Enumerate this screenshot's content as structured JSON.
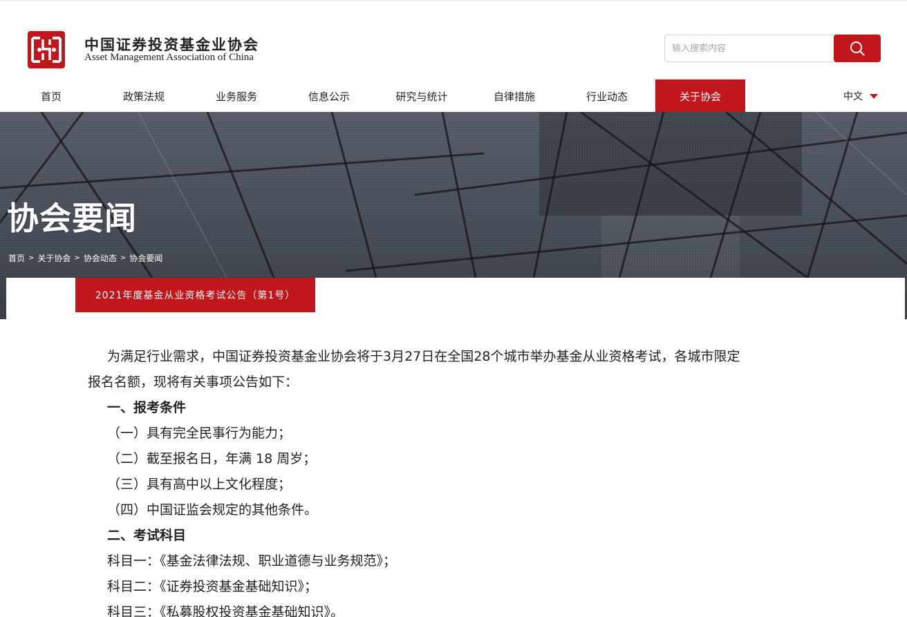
{
  "site": {
    "name_cn": "中国证券投资基金业协会",
    "name_en": "Asset Management Association of China",
    "brand_color": "#c0161c"
  },
  "search": {
    "placeholder": "输入搜索内容",
    "icon": "search-icon"
  },
  "nav": {
    "items": [
      {
        "label": "首页"
      },
      {
        "label": "政策法规"
      },
      {
        "label": "业务服务"
      },
      {
        "label": "信息公示"
      },
      {
        "label": "研究与统计"
      },
      {
        "label": "自律措施"
      },
      {
        "label": "行业动态"
      },
      {
        "label": "关于协会"
      }
    ],
    "active_index": 7,
    "language": "中文"
  },
  "banner": {
    "title": "协会要闻",
    "breadcrumb": [
      "首页",
      "关于协会",
      "协会动态",
      "协会要闻"
    ],
    "separator": ">"
  },
  "article": {
    "tag": "2021年度基金从业资格考试公告（第1号）",
    "paragraphs": [
      "为满足行业需求，中国证券投资基金业协会将于3月27日在全国28个城市举办基金从业资格考试，各城市限定",
      "报名名额，现将有关事项公告如下：",
      "一、报考条件",
      "（一）具有完全民事行为能力；",
      "（二）截至报名日，年满 18 周岁；",
      "（三）具有高中以上文化程度；",
      "（四）中国证监会规定的其他条件。",
      "二、考试科目",
      "科目一：《基金法律法规、职业道德与业务规范》；",
      "科目二：《证券投资基金基础知识》；",
      "科目三：《私募股权投资基金基础知识》。"
    ]
  }
}
